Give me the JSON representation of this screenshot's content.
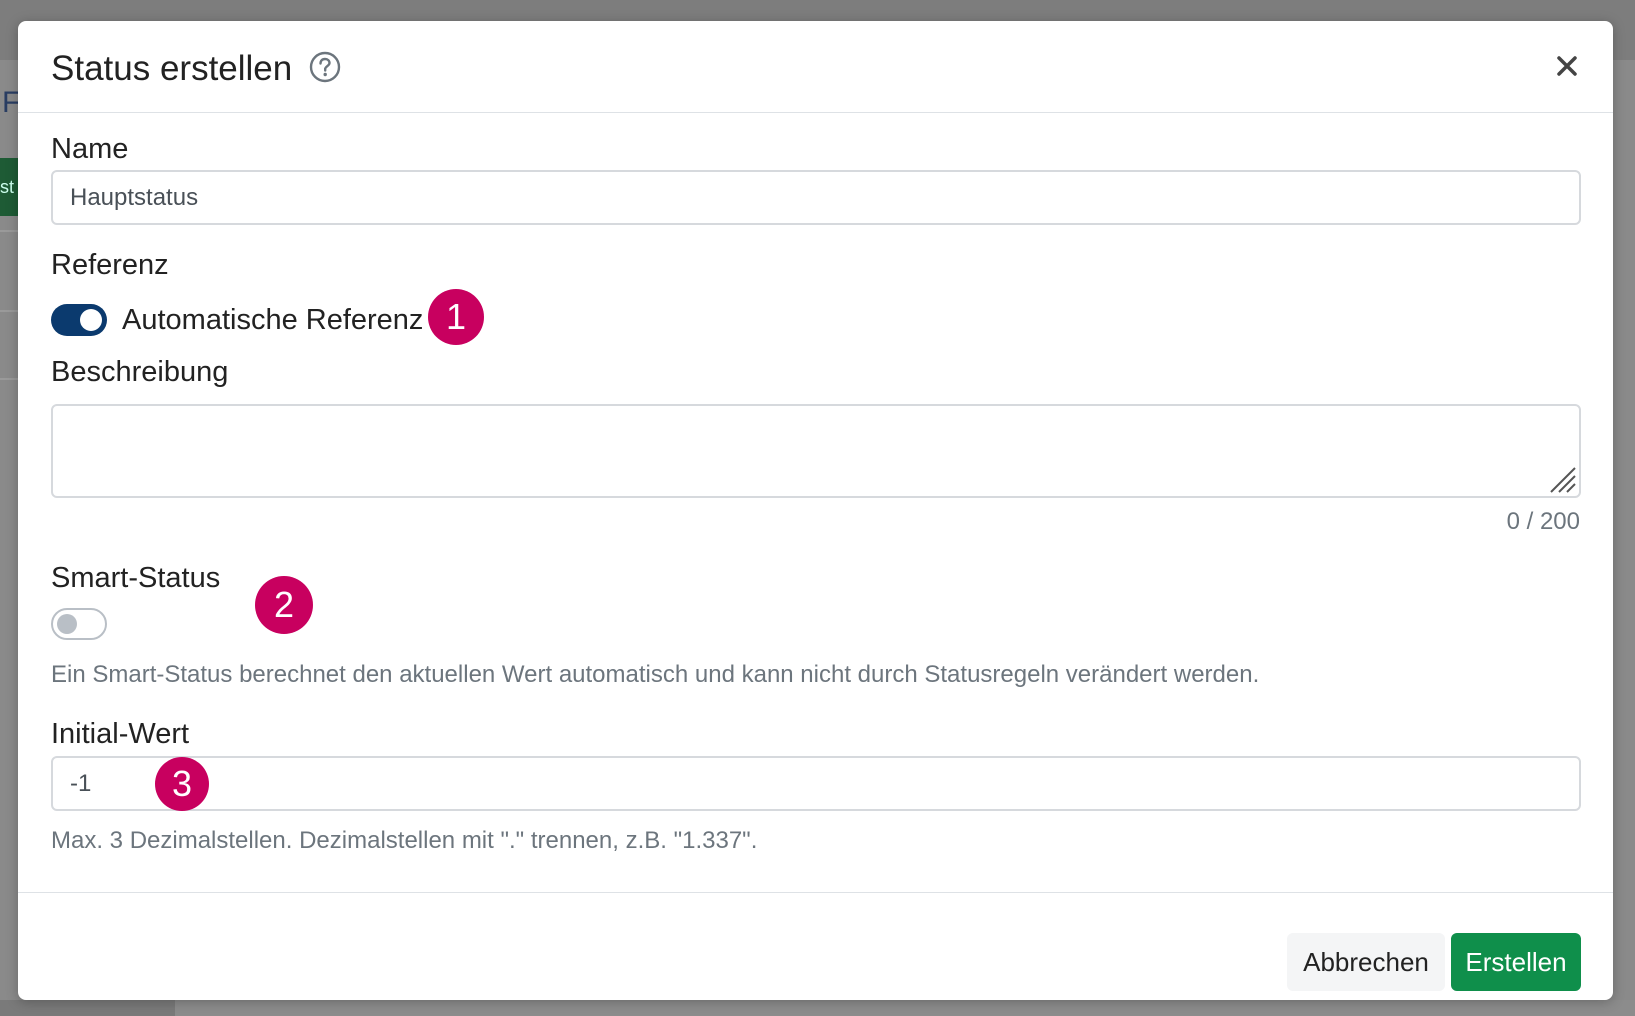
{
  "background": {
    "letter": "F",
    "button_fragment": "st"
  },
  "modal": {
    "title": "Status erstellen",
    "help_icon": "question-circle-icon",
    "close_icon": "close-icon"
  },
  "fields": {
    "name_label": "Name",
    "name_value": "Hauptstatus",
    "reference_label": "Referenz",
    "auto_reference_label": "Automatische Referenz",
    "auto_reference_on": true,
    "description_label": "Beschreibung",
    "description_value": "",
    "description_counter": "0 / 200",
    "smart_status_label": "Smart-Status",
    "smart_status_on": false,
    "smart_status_help": "Ein Smart-Status berechnet den aktuellen Wert automatisch und kann nicht durch Statusregeln verändert werden.",
    "initial_value_label": "Initial-Wert",
    "initial_value": "-1",
    "initial_value_help": "Max. 3 Dezimalstellen. Dezimalstellen mit \".\" trennen, z.B. \"1.337\"."
  },
  "annotations": {
    "badge1": "1",
    "badge2": "2",
    "badge3": "3",
    "badge_color": "#c8005f"
  },
  "footer": {
    "cancel_label": "Abbrechen",
    "create_label": "Erstellen"
  },
  "colors": {
    "primary": "#0b3a6e",
    "success": "#0f8f4b"
  }
}
